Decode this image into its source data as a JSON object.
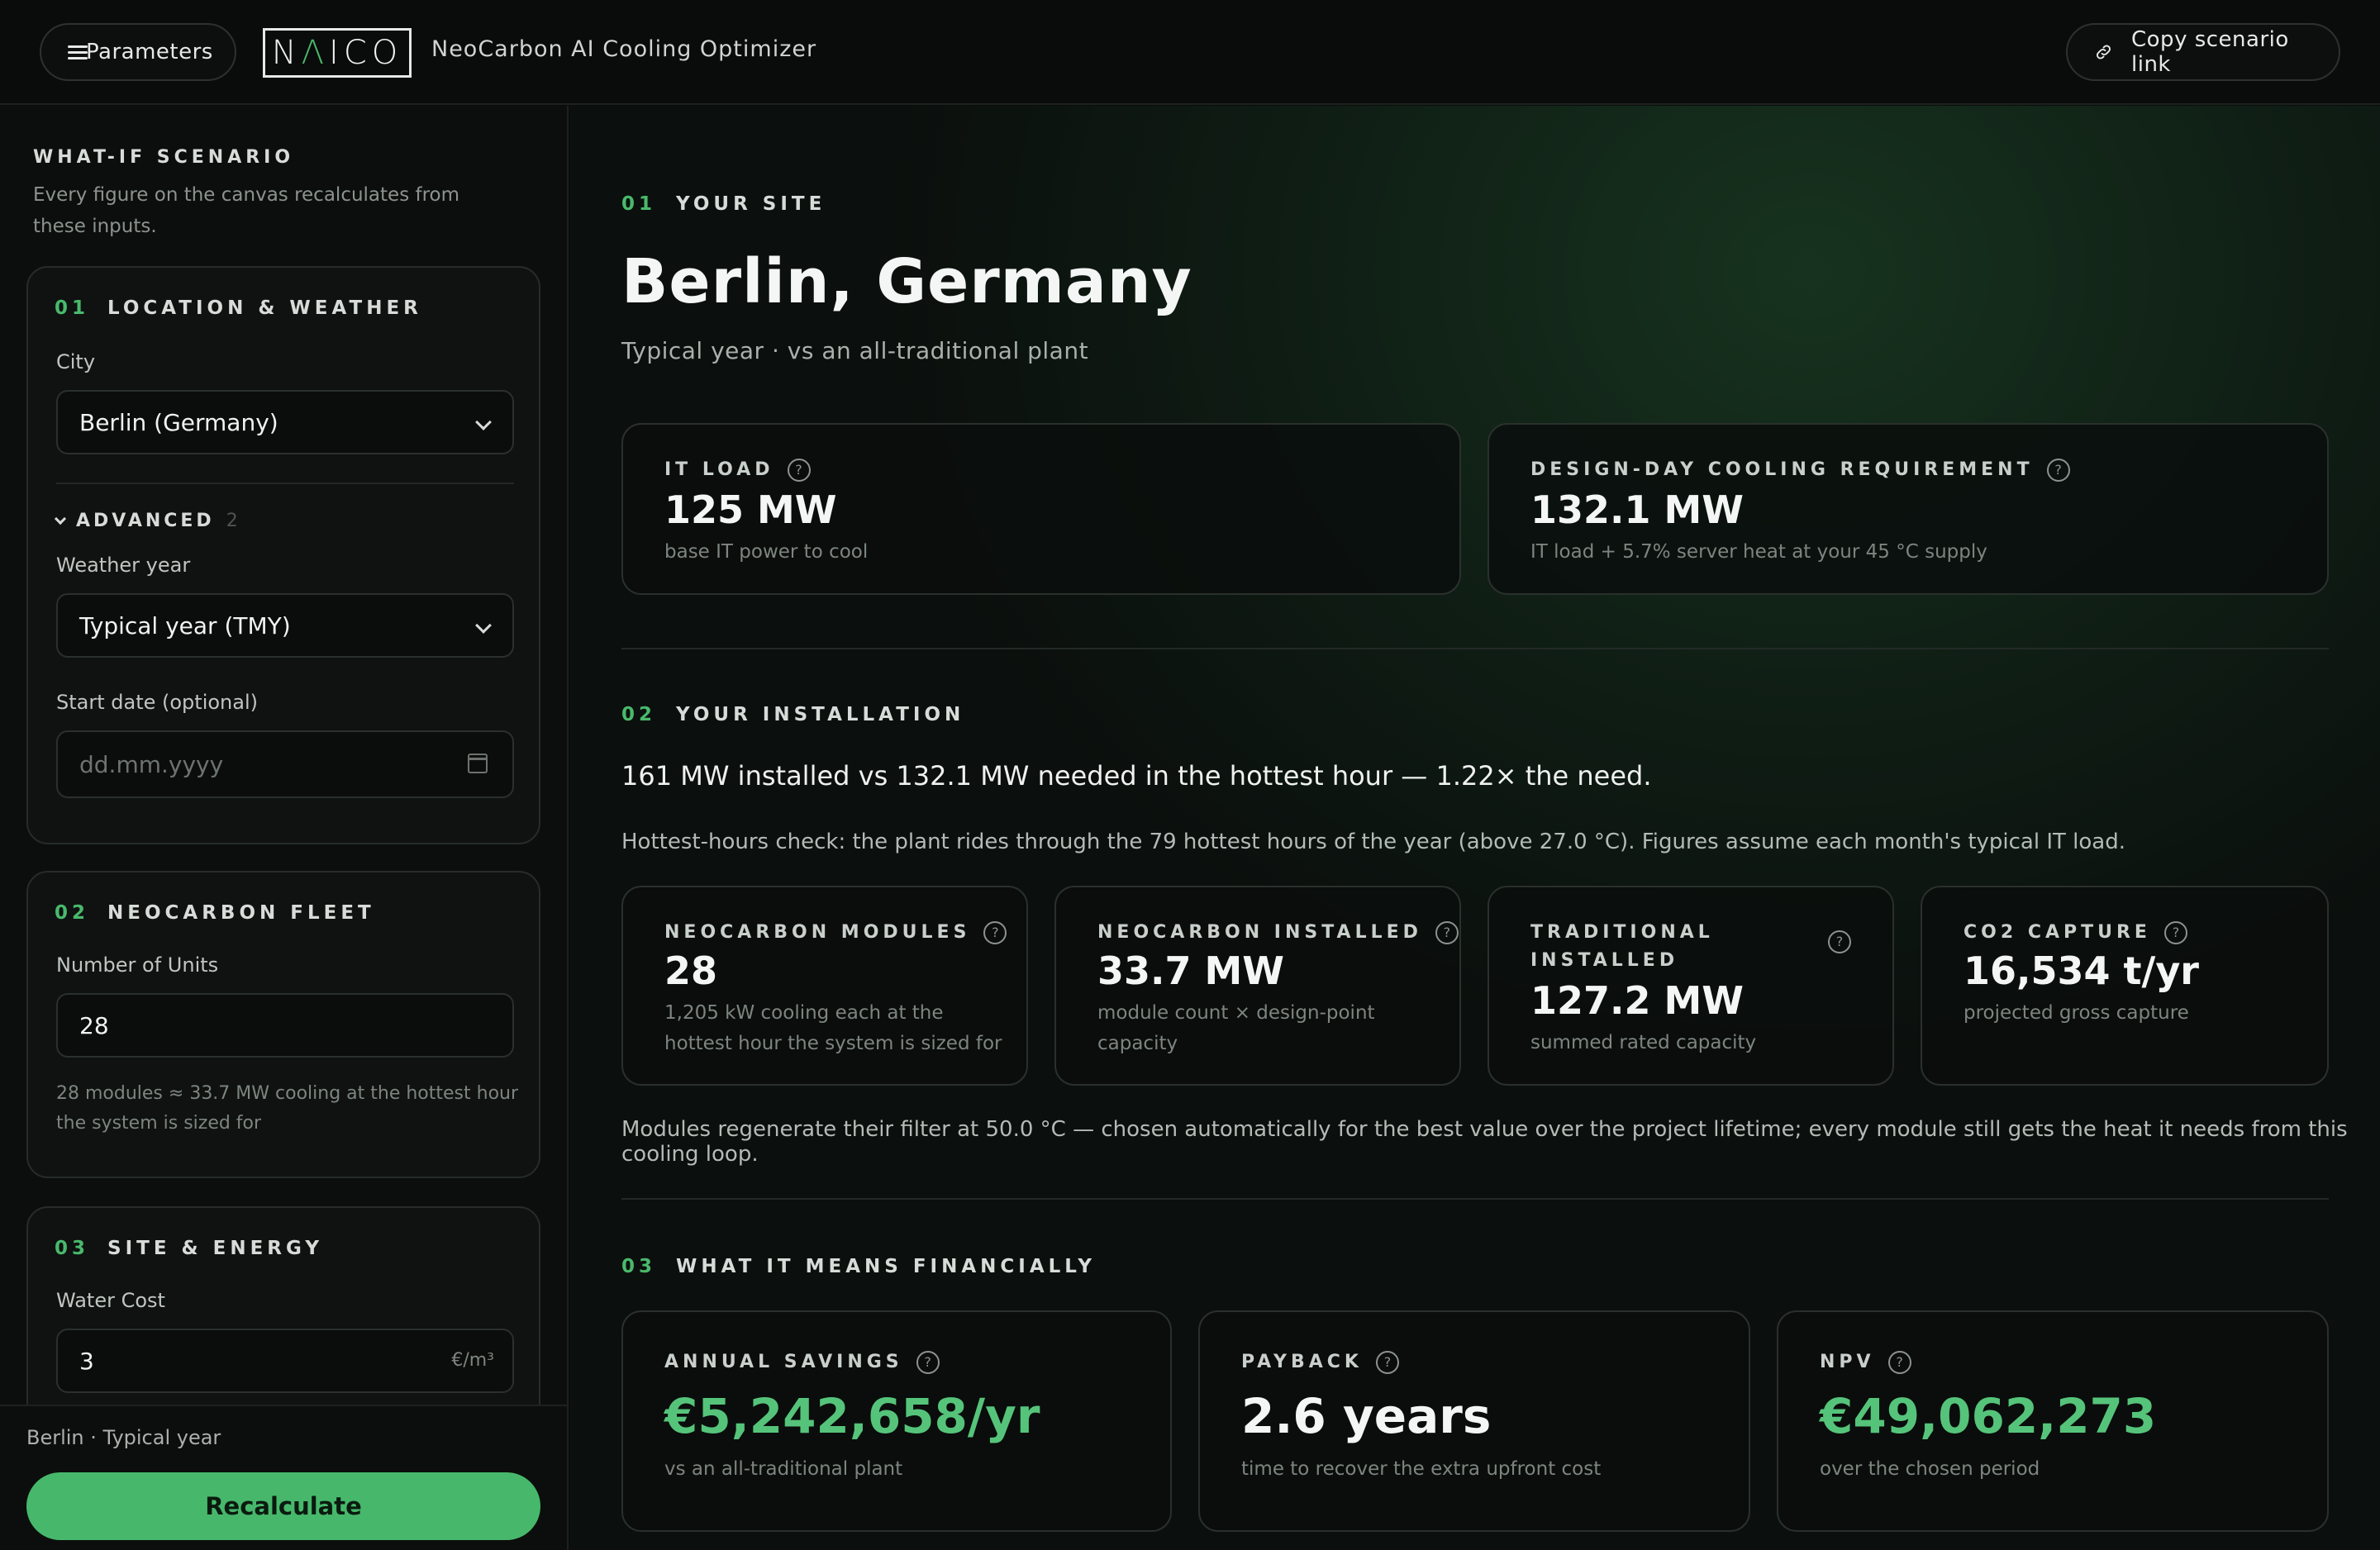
{
  "topbar": {
    "params_label": "Parameters",
    "logo_text_1": "N",
    "logo_text_accent": "Λ",
    "logo_text_2": "ICO",
    "app_title": "NeoCarbon AI Cooling Optimizer",
    "copy_label": "Copy scenario link"
  },
  "sidebar": {
    "title": "WHAT-IF SCENARIO",
    "subtitle": "Every figure on the canvas recalculates from these inputs.",
    "location": {
      "num": "01",
      "title": "LOCATION & WEATHER",
      "city_label": "City",
      "city_value": "Berlin (Germany)",
      "advanced_label": "ADVANCED",
      "advanced_count": "2",
      "weather_label": "Weather year",
      "weather_value": "Typical year (TMY)",
      "start_label": "Start date (optional)",
      "start_placeholder": "dd.mm.yyyy"
    },
    "fleet": {
      "num": "02",
      "title": "NEOCARBON FLEET",
      "units_label": "Number of Units",
      "units_value": "28",
      "hint": "28 modules ≈ 33.7 MW cooling at the hottest hour the system is sized for"
    },
    "energy": {
      "num": "03",
      "title": "SITE & ENERGY",
      "water_label": "Water Cost",
      "water_value": "3",
      "water_unit": "€/m³"
    },
    "footer": {
      "scenario": "Berlin · Typical year",
      "recalc_label": "Recalculate"
    }
  },
  "main": {
    "site": {
      "num": "01",
      "label": "YOUR SITE",
      "title": "Berlin, Germany",
      "subtitle": "Typical year · vs an all-traditional plant",
      "it_load": {
        "label": "IT LOAD",
        "value": "125 MW",
        "desc": "base IT power to cool"
      },
      "design_day": {
        "label": "DESIGN-DAY COOLING REQUIREMENT",
        "value": "132.1 MW",
        "desc": "IT load + 5.7% server heat at your 45 °C supply"
      }
    },
    "installation": {
      "num": "02",
      "label": "YOUR INSTALLATION",
      "summary": "161 MW installed vs 132.1 MW needed in the hottest hour — 1.22× the need.",
      "note": "Hottest-hours check: the plant rides through the 79 hottest hours of the year (above 27.0 °C). Figures assume each month's typical IT load.",
      "modules": {
        "label": "NEOCARBON MODULES",
        "value": "28",
        "desc": "1,205 kW cooling each at the hottest hour the system is sized for"
      },
      "neo_installed": {
        "label": "NEOCARBON INSTALLED",
        "value": "33.7 MW",
        "desc": "module count × design-point capacity"
      },
      "trad_installed": {
        "label": "TRADITIONAL INSTALLED",
        "value": "127.2 MW",
        "desc": "summed rated capacity"
      },
      "co2": {
        "label": "CO2 CAPTURE",
        "value": "16,534 t/yr",
        "desc": "projected gross capture"
      },
      "footnote": "Modules regenerate their filter at 50.0 °C — chosen automatically for the best value over the project lifetime; every module still gets the heat it needs from this cooling loop."
    },
    "financial": {
      "num": "03",
      "label": "WHAT IT MEANS FINANCIALLY",
      "savings": {
        "label": "ANNUAL SAVINGS",
        "value": "€5,242,658/yr",
        "desc": "vs an all-traditional plant"
      },
      "payback": {
        "label": "PAYBACK",
        "value": "2.6 years",
        "desc": "time to recover the extra upfront cost"
      },
      "npv": {
        "label": "NPV",
        "value": "€49,062,273",
        "desc": "over the chosen period"
      }
    }
  },
  "colors": {
    "accent": "#47b86b",
    "background": "#0b0d0c"
  }
}
